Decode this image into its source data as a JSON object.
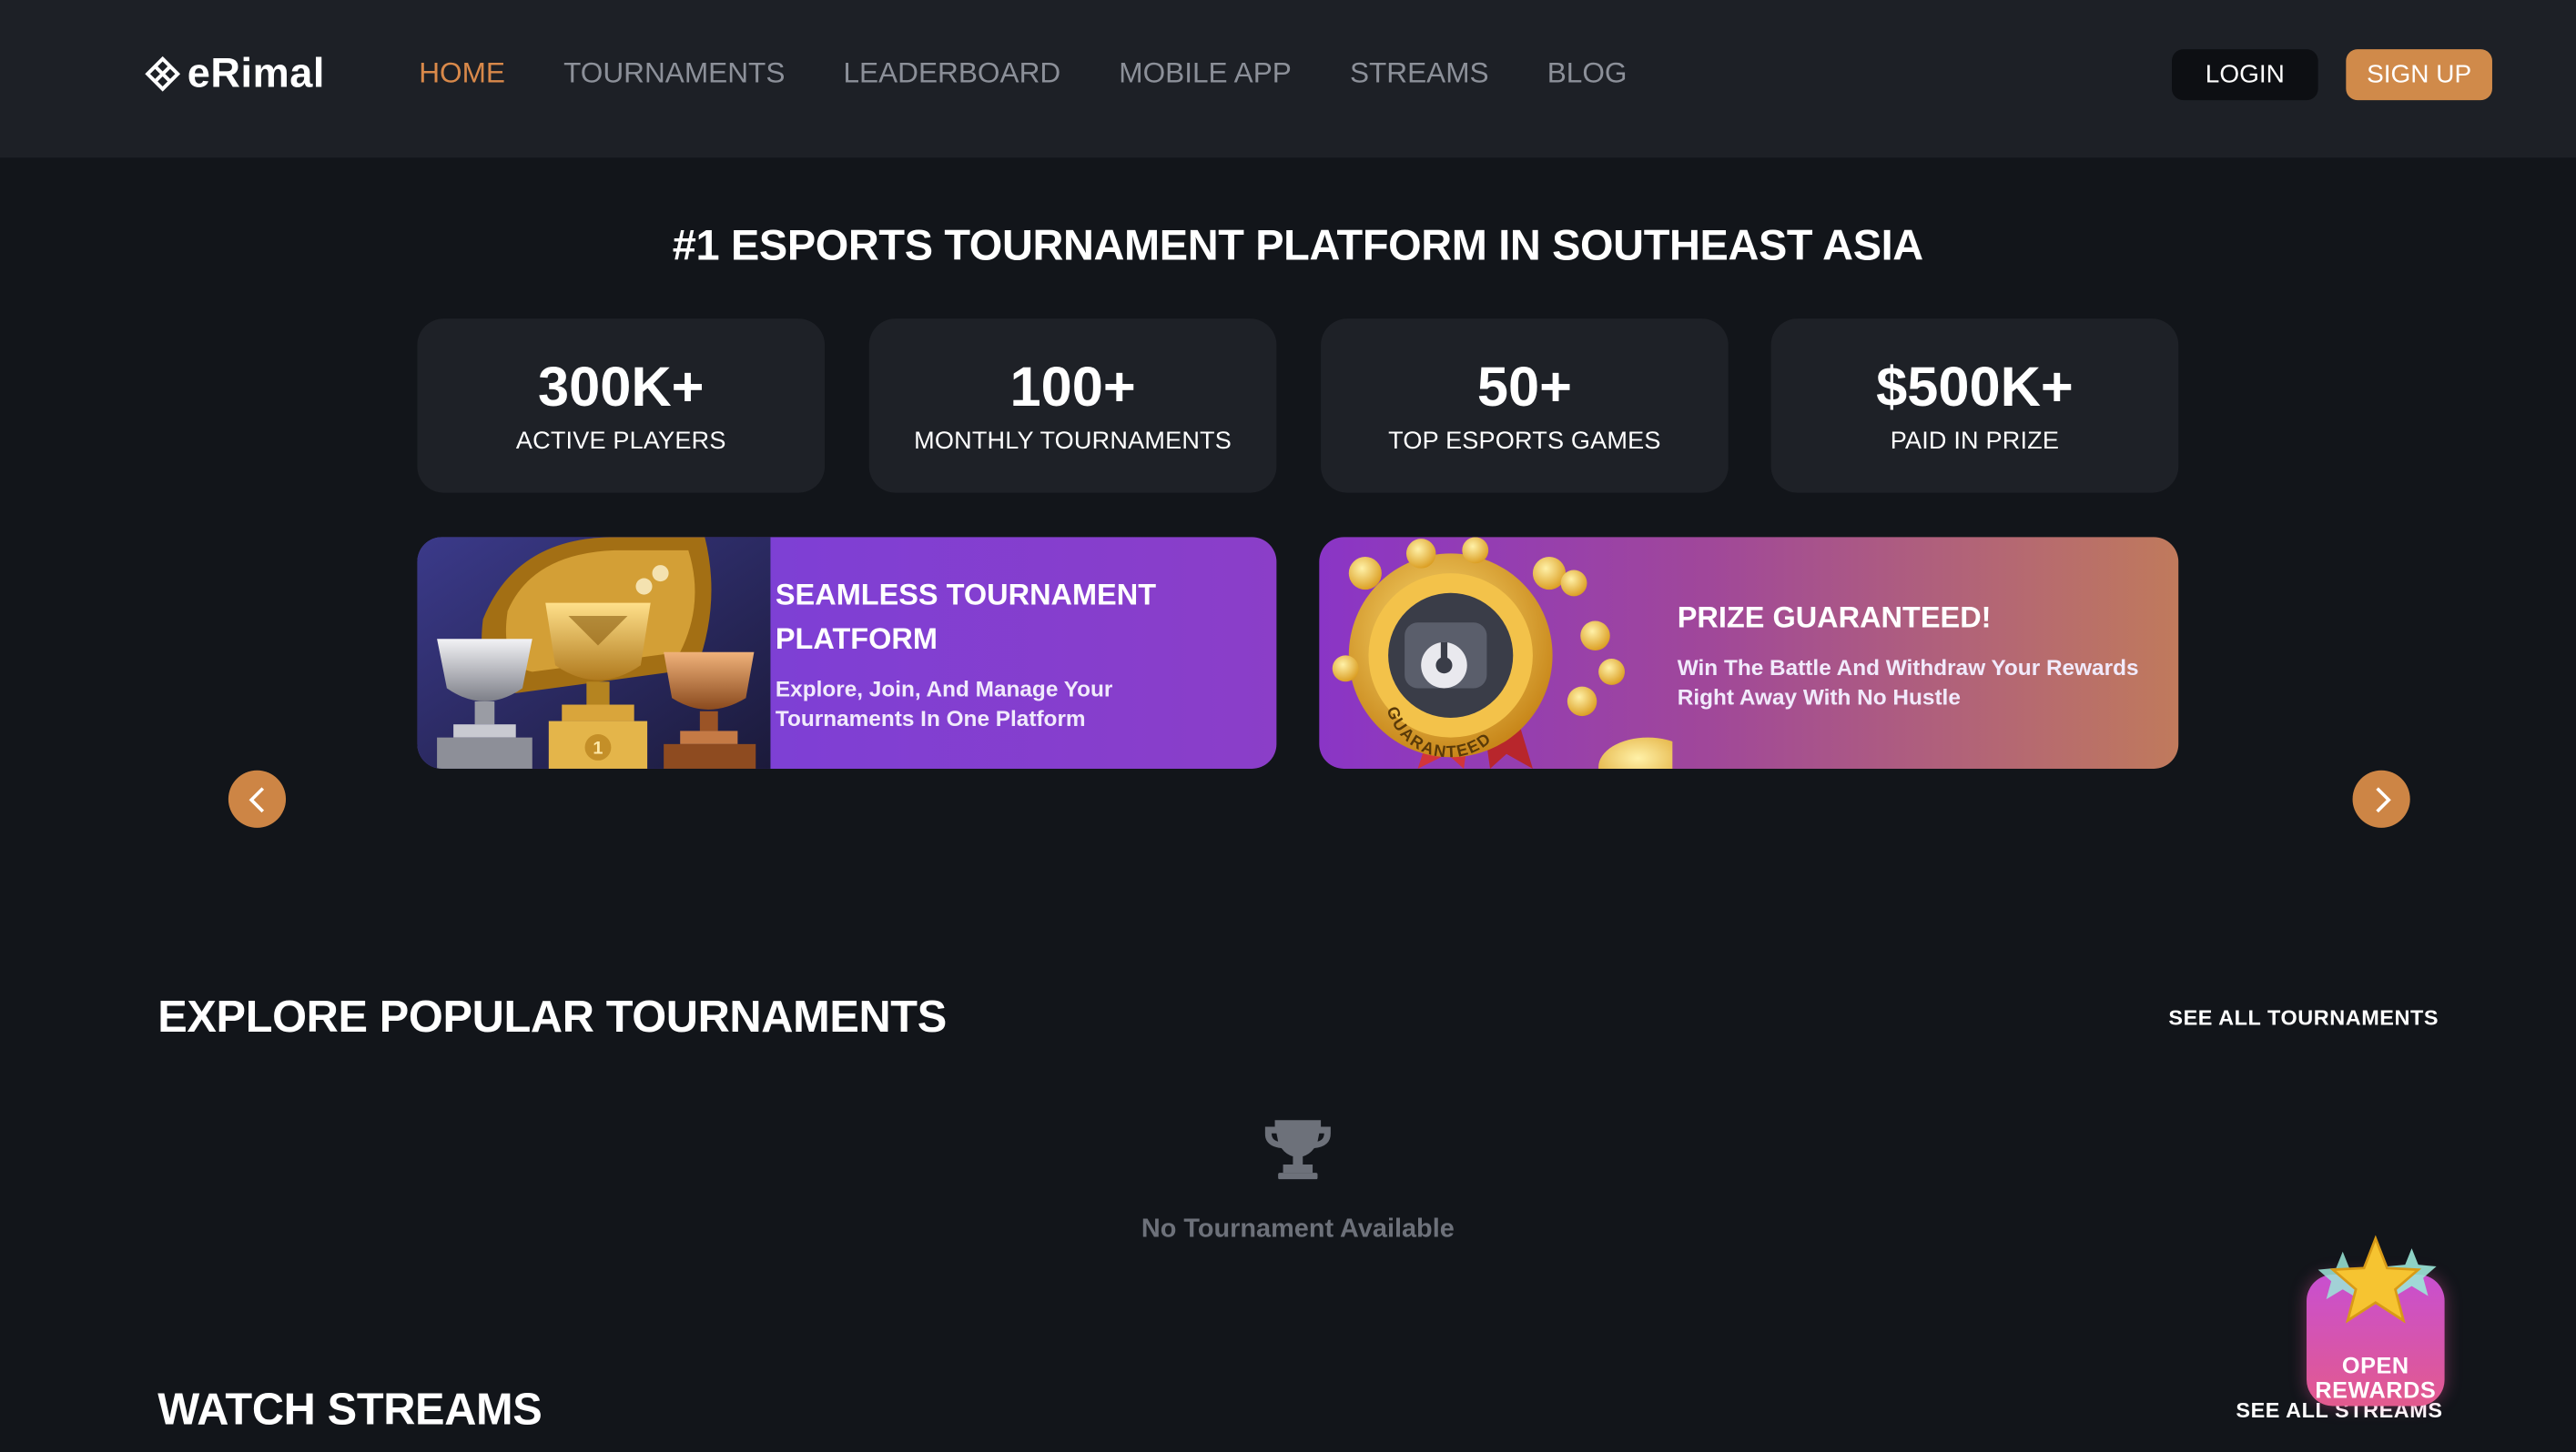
{
  "header": {
    "brand": "eRimal",
    "nav": [
      "HOME",
      "TOURNAMENTS",
      "LEADERBOARD",
      "MOBILE APP",
      "STREAMS",
      "BLOG"
    ],
    "active_nav": "HOME",
    "login_label": "LOGIN",
    "signup_label": "SIGN UP"
  },
  "hero": {
    "title": "#1 ESPORTS TOURNAMENT PLATFORM IN SOUTHEAST ASIA",
    "stats": [
      {
        "value": "300K+",
        "label": "ACTIVE PLAYERS"
      },
      {
        "value": "100+",
        "label": "MONTHLY TOURNAMENTS"
      },
      {
        "value": "50+",
        "label": "TOP ESPORTS GAMES"
      },
      {
        "value": "$500K+",
        "label": "PAID IN PRIZE"
      }
    ]
  },
  "banners": [
    {
      "title": "SEAMLESS TOURNAMENT PLATFORM",
      "description": "Explore, Join, And Manage Your Tournaments In One Platform",
      "badge": "1"
    },
    {
      "title": "PRIZE GUARANTEED!",
      "description": "Win The Battle And Withdraw Your Rewards Right Away With No Hustle",
      "seal_text": "GUARANTEED"
    }
  ],
  "tournaments": {
    "title": "EXPLORE POPULAR TOURNAMENTS",
    "see_all": "SEE ALL TOURNAMENTS",
    "empty_text": "No Tournament Available"
  },
  "streams": {
    "title": "WATCH STREAMS",
    "see_all": "SEE ALL STREAMS"
  },
  "rewards": {
    "label": "OPEN REWARDS"
  },
  "colors": {
    "accent": "#d08a4a",
    "page_bg": "#12151a",
    "header_bg": "#1d2026",
    "card_bg": "#1e2127"
  }
}
